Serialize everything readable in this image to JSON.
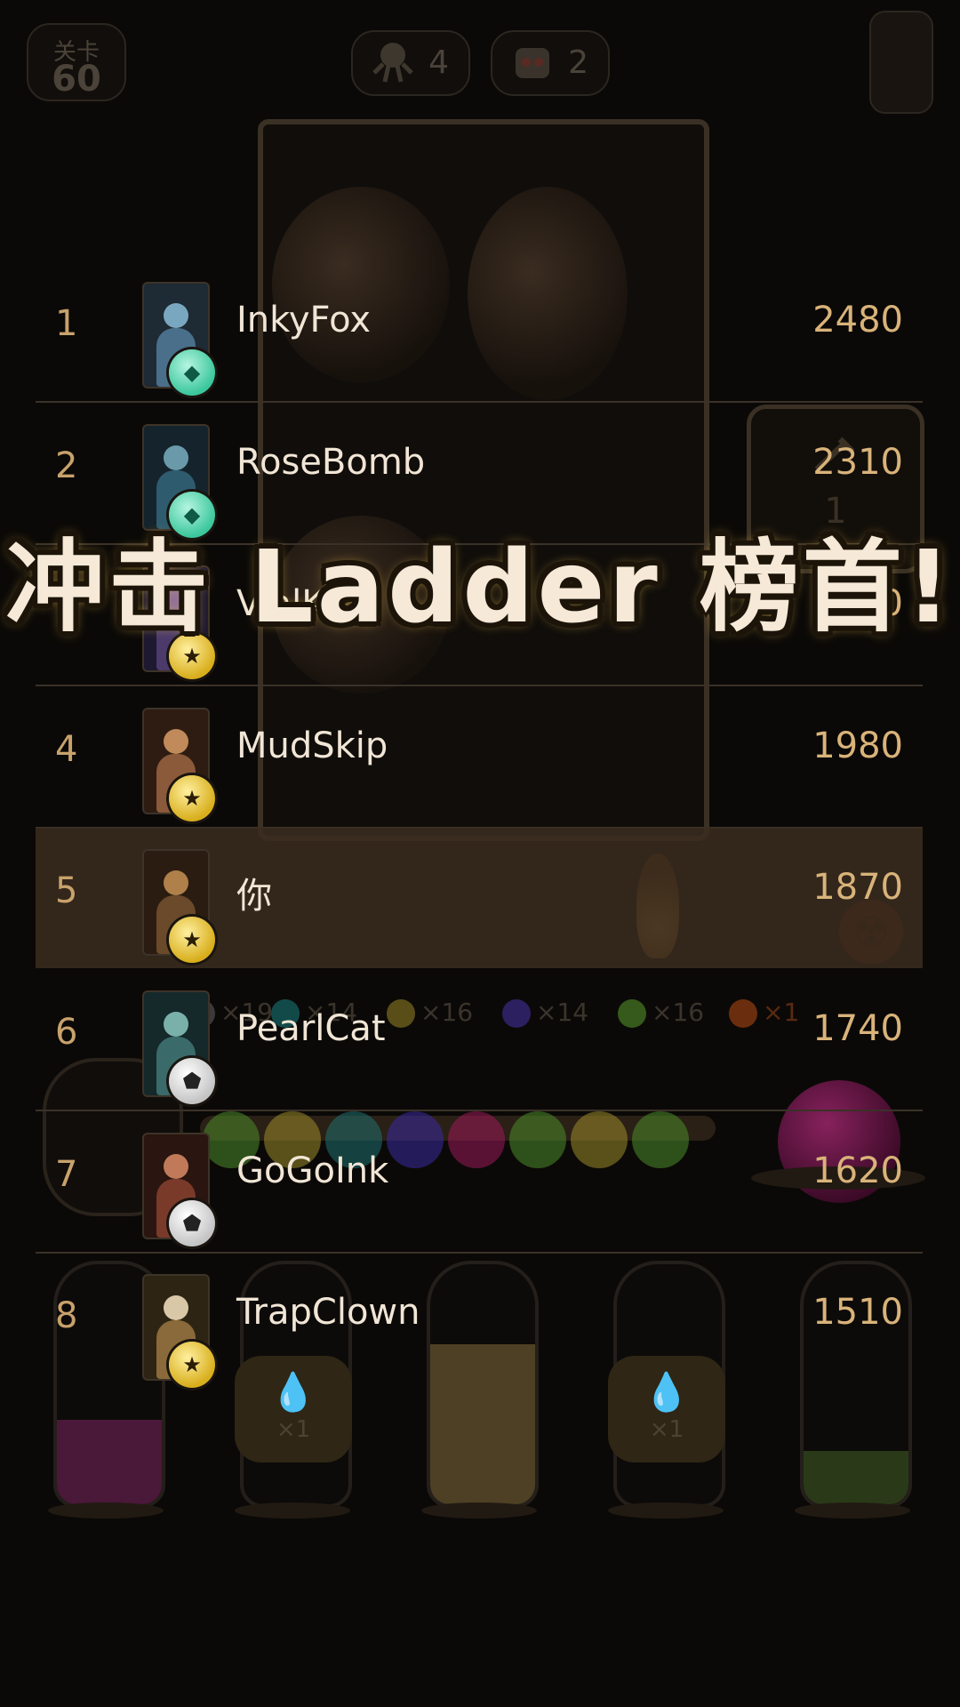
{
  "hud": {
    "level_label": "关卡",
    "level_value": "60",
    "counter_a": "4",
    "counter_b": "2"
  },
  "hint": {
    "value": "1"
  },
  "orbs": [
    {
      "color": "#6a6a6a",
      "count": "×19"
    },
    {
      "color": "#1f8c8c",
      "count": "×14"
    },
    {
      "color": "#c9b23a",
      "count": "×16"
    },
    {
      "color": "#5a3fc0",
      "count": "×14"
    },
    {
      "color": "#6fbf3a",
      "count": "×16"
    },
    {
      "color": "#e0651e",
      "count": "×1"
    }
  ],
  "bottles": {
    "drop_count_left": "×1",
    "drop_count_right": "×1"
  },
  "headline": "冲击 Ladder 榜首!",
  "leaderboard": [
    {
      "rank": "1",
      "name": "InkyFox",
      "score": "2480",
      "badge": "diamond",
      "badge_glyph": "◆",
      "avatar_color": "#4a6f8a"
    },
    {
      "rank": "2",
      "name": "RoseBomb",
      "score": "2310",
      "badge": "diamond",
      "badge_glyph": "◆",
      "avatar_color": "#2f5b6e"
    },
    {
      "rank": "3",
      "name": "VialKing",
      "score": "2190",
      "badge": "star",
      "badge_glyph": "★",
      "avatar_color": "#4b3a6a"
    },
    {
      "rank": "4",
      "name": "MudSkip",
      "score": "1980",
      "badge": "star",
      "badge_glyph": "★",
      "avatar_color": "#8a5a3a"
    },
    {
      "rank": "5",
      "name": "你",
      "score": "1870",
      "badge": "star",
      "badge_glyph": "★",
      "avatar_color": "#6a4a2a"
    },
    {
      "rank": "6",
      "name": "PearlCat",
      "score": "1740",
      "badge": "shield",
      "badge_glyph": "⬟",
      "avatar_color": "#3a6a6a"
    },
    {
      "rank": "7",
      "name": "GoGoInk",
      "score": "1620",
      "badge": "shield",
      "badge_glyph": "⬟",
      "avatar_color": "#7a3a2a"
    },
    {
      "rank": "8",
      "name": "TrapClown",
      "score": "1510",
      "badge": "star",
      "badge_glyph": "★",
      "avatar_color": "#8a6a3a"
    }
  ]
}
